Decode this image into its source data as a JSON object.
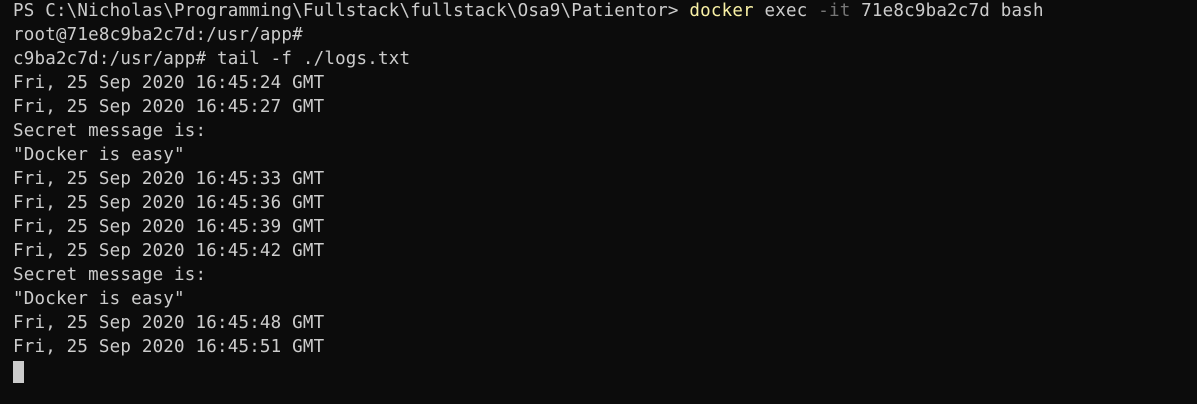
{
  "terminal": {
    "prompt_line": {
      "prompt": "PS C:\\Nicholas\\Programming\\Fullstack\\fullstack\\Osa9\\Patientor> ",
      "command": "docker",
      "args_before_flag": " exec ",
      "flag": "-it",
      "args_after_flag": " 71e8c9ba2c7d bash"
    },
    "lines": [
      "root@71e8c9ba2c7d:/usr/app#",
      "c9ba2c7d:/usr/app# tail -f ./logs.txt",
      "Fri, 25 Sep 2020 16:45:24 GMT",
      "Fri, 25 Sep 2020 16:45:27 GMT",
      "Secret message is:",
      "\"Docker is easy\"",
      "Fri, 25 Sep 2020 16:45:33 GMT",
      "Fri, 25 Sep 2020 16:45:36 GMT",
      "Fri, 25 Sep 2020 16:45:39 GMT",
      "Fri, 25 Sep 2020 16:45:42 GMT",
      "Secret message is:",
      "\"Docker is easy\"",
      "Fri, 25 Sep 2020 16:45:48 GMT",
      "Fri, 25 Sep 2020 16:45:51 GMT"
    ]
  },
  "colors": {
    "background": "#0c0c0c",
    "foreground": "#cccccc",
    "command_highlight": "#f9f1a5",
    "flag": "#767676"
  }
}
